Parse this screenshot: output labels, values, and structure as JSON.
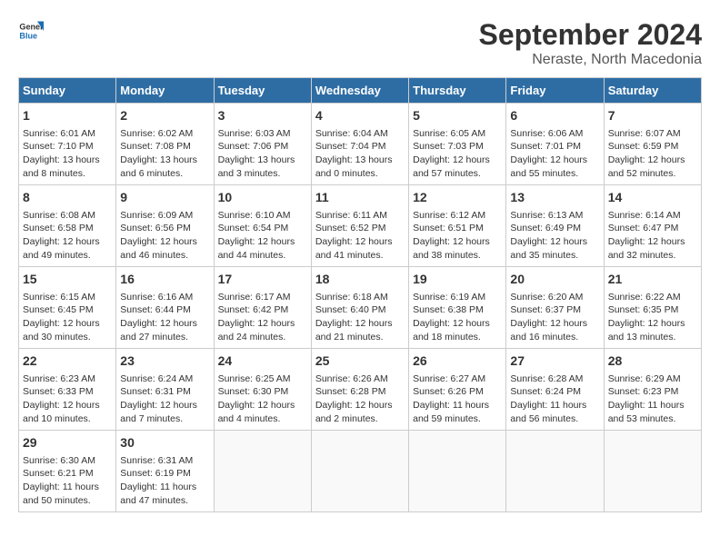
{
  "header": {
    "logo_line1": "General",
    "logo_line2": "Blue",
    "month": "September 2024",
    "location": "Neraste, North Macedonia"
  },
  "days_of_week": [
    "Sunday",
    "Monday",
    "Tuesday",
    "Wednesday",
    "Thursday",
    "Friday",
    "Saturday"
  ],
  "weeks": [
    [
      {
        "day": 1,
        "lines": [
          "Sunrise: 6:01 AM",
          "Sunset: 7:10 PM",
          "Daylight: 13 hours",
          "and 8 minutes."
        ]
      },
      {
        "day": 2,
        "lines": [
          "Sunrise: 6:02 AM",
          "Sunset: 7:08 PM",
          "Daylight: 13 hours",
          "and 6 minutes."
        ]
      },
      {
        "day": 3,
        "lines": [
          "Sunrise: 6:03 AM",
          "Sunset: 7:06 PM",
          "Daylight: 13 hours",
          "and 3 minutes."
        ]
      },
      {
        "day": 4,
        "lines": [
          "Sunrise: 6:04 AM",
          "Sunset: 7:04 PM",
          "Daylight: 13 hours",
          "and 0 minutes."
        ]
      },
      {
        "day": 5,
        "lines": [
          "Sunrise: 6:05 AM",
          "Sunset: 7:03 PM",
          "Daylight: 12 hours",
          "and 57 minutes."
        ]
      },
      {
        "day": 6,
        "lines": [
          "Sunrise: 6:06 AM",
          "Sunset: 7:01 PM",
          "Daylight: 12 hours",
          "and 55 minutes."
        ]
      },
      {
        "day": 7,
        "lines": [
          "Sunrise: 6:07 AM",
          "Sunset: 6:59 PM",
          "Daylight: 12 hours",
          "and 52 minutes."
        ]
      }
    ],
    [
      {
        "day": 8,
        "lines": [
          "Sunrise: 6:08 AM",
          "Sunset: 6:58 PM",
          "Daylight: 12 hours",
          "and 49 minutes."
        ]
      },
      {
        "day": 9,
        "lines": [
          "Sunrise: 6:09 AM",
          "Sunset: 6:56 PM",
          "Daylight: 12 hours",
          "and 46 minutes."
        ]
      },
      {
        "day": 10,
        "lines": [
          "Sunrise: 6:10 AM",
          "Sunset: 6:54 PM",
          "Daylight: 12 hours",
          "and 44 minutes."
        ]
      },
      {
        "day": 11,
        "lines": [
          "Sunrise: 6:11 AM",
          "Sunset: 6:52 PM",
          "Daylight: 12 hours",
          "and 41 minutes."
        ]
      },
      {
        "day": 12,
        "lines": [
          "Sunrise: 6:12 AM",
          "Sunset: 6:51 PM",
          "Daylight: 12 hours",
          "and 38 minutes."
        ]
      },
      {
        "day": 13,
        "lines": [
          "Sunrise: 6:13 AM",
          "Sunset: 6:49 PM",
          "Daylight: 12 hours",
          "and 35 minutes."
        ]
      },
      {
        "day": 14,
        "lines": [
          "Sunrise: 6:14 AM",
          "Sunset: 6:47 PM",
          "Daylight: 12 hours",
          "and 32 minutes."
        ]
      }
    ],
    [
      {
        "day": 15,
        "lines": [
          "Sunrise: 6:15 AM",
          "Sunset: 6:45 PM",
          "Daylight: 12 hours",
          "and 30 minutes."
        ]
      },
      {
        "day": 16,
        "lines": [
          "Sunrise: 6:16 AM",
          "Sunset: 6:44 PM",
          "Daylight: 12 hours",
          "and 27 minutes."
        ]
      },
      {
        "day": 17,
        "lines": [
          "Sunrise: 6:17 AM",
          "Sunset: 6:42 PM",
          "Daylight: 12 hours",
          "and 24 minutes."
        ]
      },
      {
        "day": 18,
        "lines": [
          "Sunrise: 6:18 AM",
          "Sunset: 6:40 PM",
          "Daylight: 12 hours",
          "and 21 minutes."
        ]
      },
      {
        "day": 19,
        "lines": [
          "Sunrise: 6:19 AM",
          "Sunset: 6:38 PM",
          "Daylight: 12 hours",
          "and 18 minutes."
        ]
      },
      {
        "day": 20,
        "lines": [
          "Sunrise: 6:20 AM",
          "Sunset: 6:37 PM",
          "Daylight: 12 hours",
          "and 16 minutes."
        ]
      },
      {
        "day": 21,
        "lines": [
          "Sunrise: 6:22 AM",
          "Sunset: 6:35 PM",
          "Daylight: 12 hours",
          "and 13 minutes."
        ]
      }
    ],
    [
      {
        "day": 22,
        "lines": [
          "Sunrise: 6:23 AM",
          "Sunset: 6:33 PM",
          "Daylight: 12 hours",
          "and 10 minutes."
        ]
      },
      {
        "day": 23,
        "lines": [
          "Sunrise: 6:24 AM",
          "Sunset: 6:31 PM",
          "Daylight: 12 hours",
          "and 7 minutes."
        ]
      },
      {
        "day": 24,
        "lines": [
          "Sunrise: 6:25 AM",
          "Sunset: 6:30 PM",
          "Daylight: 12 hours",
          "and 4 minutes."
        ]
      },
      {
        "day": 25,
        "lines": [
          "Sunrise: 6:26 AM",
          "Sunset: 6:28 PM",
          "Daylight: 12 hours",
          "and 2 minutes."
        ]
      },
      {
        "day": 26,
        "lines": [
          "Sunrise: 6:27 AM",
          "Sunset: 6:26 PM",
          "Daylight: 11 hours",
          "and 59 minutes."
        ]
      },
      {
        "day": 27,
        "lines": [
          "Sunrise: 6:28 AM",
          "Sunset: 6:24 PM",
          "Daylight: 11 hours",
          "and 56 minutes."
        ]
      },
      {
        "day": 28,
        "lines": [
          "Sunrise: 6:29 AM",
          "Sunset: 6:23 PM",
          "Daylight: 11 hours",
          "and 53 minutes."
        ]
      }
    ],
    [
      {
        "day": 29,
        "lines": [
          "Sunrise: 6:30 AM",
          "Sunset: 6:21 PM",
          "Daylight: 11 hours",
          "and 50 minutes."
        ]
      },
      {
        "day": 30,
        "lines": [
          "Sunrise: 6:31 AM",
          "Sunset: 6:19 PM",
          "Daylight: 11 hours",
          "and 47 minutes."
        ]
      },
      null,
      null,
      null,
      null,
      null
    ]
  ]
}
